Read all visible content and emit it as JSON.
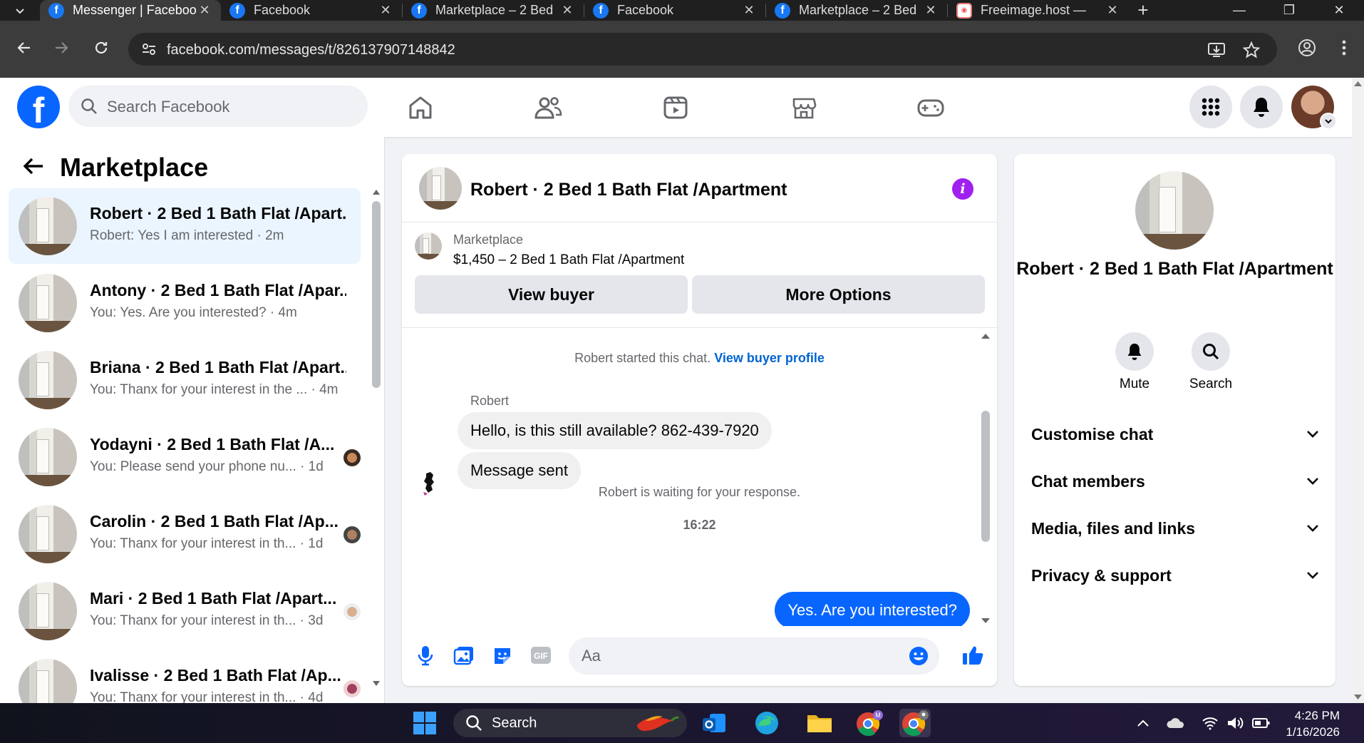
{
  "browser": {
    "tabs": [
      {
        "title": "Messenger | Facebook",
        "active": true
      },
      {
        "title": "Facebook",
        "active": false
      },
      {
        "title": "Marketplace – 2 Bed",
        "active": false
      },
      {
        "title": "Facebook",
        "active": false
      },
      {
        "title": "Marketplace – 2 Bed",
        "active": false
      },
      {
        "title": "Freeimage.host — ",
        "active": false
      }
    ],
    "url": "facebook.com/messages/t/826137907148842"
  },
  "fb": {
    "search_placeholder": "Search Facebook",
    "brand_color": "#0866ff"
  },
  "left": {
    "title": "Marketplace",
    "conversations": [
      {
        "name": "Robert · 2 Bed 1 Bath Flat /Apart...",
        "snippet": "Robert: Yes I am interested · 2m",
        "active": true
      },
      {
        "name": "Antony · 2 Bed 1 Bath Flat /Apar...",
        "snippet": "You: Yes. Are you interested? · 4m"
      },
      {
        "name": "Briana · 2 Bed 1 Bath Flat /Apart...",
        "snippet": "You: Thanx for your interest in the ... · 4m"
      },
      {
        "name": "Yodayni · 2 Bed 1 Bath Flat /A...",
        "snippet": "You: Please send your phone nu... · 1d"
      },
      {
        "name": "Carolin · 2 Bed 1 Bath Flat /Ap...",
        "snippet": "You: Thanx for your interest in th... · 1d"
      },
      {
        "name": "Mari · 2 Bed 1 Bath Flat /Apart...",
        "snippet": "You: Thanx for your interest in th... · 3d"
      },
      {
        "name": "Ivalisse · 2 Bed 1 Bath Flat /Ap...",
        "snippet": "You: Thanx for your interest in th... · 4d"
      }
    ]
  },
  "chat": {
    "title": "Robert · 2 Bed 1 Bath Flat /Apartment",
    "listing_category": "Marketplace",
    "listing_desc": "$1,450 – 2 Bed 1 Bath Flat /Apartment",
    "view_buyer": "View buyer",
    "more_options": "More Options",
    "started": "Robert started this chat.",
    "view_profile": "View buyer profile",
    "sender": "Robert",
    "msg1": "Hello, is this still available? 862-439-7920",
    "msg2": "Message sent",
    "waiting": "Robert is waiting for your response.",
    "time": "16:22",
    "msg_out": "Yes. Are you interested?",
    "composer_placeholder": "Aa"
  },
  "right": {
    "name": "Robert · 2 Bed 1 Bath Flat /Apartment",
    "mute": "Mute",
    "search": "Search",
    "sections": [
      "Customise chat",
      "Chat members",
      "Media, files and links",
      "Privacy & support"
    ]
  },
  "taskbar": {
    "search": "Search",
    "time": "4:26 PM",
    "date": "1/16/2026"
  }
}
